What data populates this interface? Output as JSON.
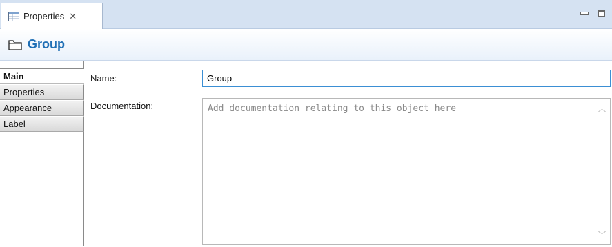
{
  "tab": {
    "label": "Properties",
    "icon": "properties-table-icon",
    "close": "✕"
  },
  "header": {
    "title": "Group",
    "icon": "folder-icon",
    "accent_color": "#1f6fb5"
  },
  "sidebar": {
    "items": [
      {
        "label": "Main",
        "selected": true
      },
      {
        "label": "Properties",
        "selected": false
      },
      {
        "label": "Appearance",
        "selected": false
      },
      {
        "label": "Label",
        "selected": false
      }
    ]
  },
  "form": {
    "name_label": "Name:",
    "name_value": "Group",
    "documentation_label": "Documentation:",
    "documentation_placeholder": "Add documentation relating to this object here"
  }
}
